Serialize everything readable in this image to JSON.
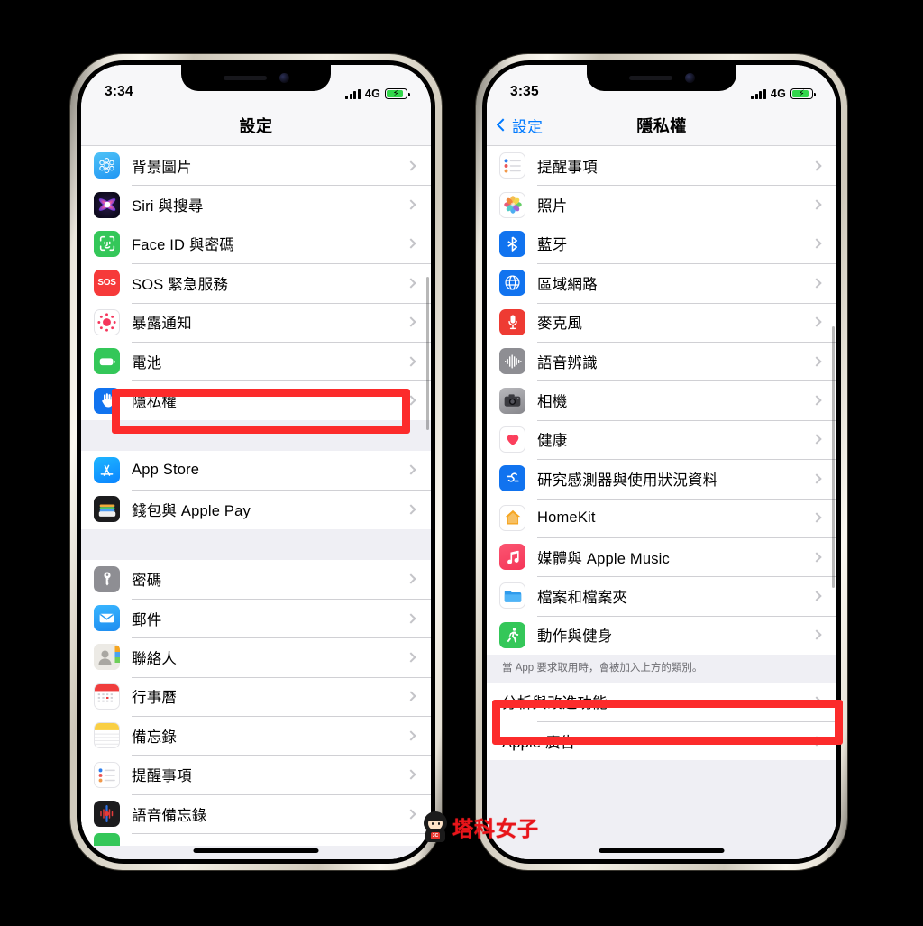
{
  "watermark": {
    "text": "塔科女子",
    "badge": "3C"
  },
  "phones": [
    {
      "id": "phone-settings",
      "status": {
        "time": "3:34",
        "network": "4G",
        "charging": true
      },
      "nav": {
        "title": "設定",
        "back_label": null
      },
      "sections": [
        {
          "type": "list",
          "rows": [
            {
              "label": "背景圖片",
              "icon": "wallpaper-icon"
            },
            {
              "label": "Siri 與搜尋",
              "icon": "siri-icon"
            },
            {
              "label": "Face ID 與密碼",
              "icon": "faceid-icon"
            },
            {
              "label": "SOS 緊急服務",
              "icon": "sos-icon"
            },
            {
              "label": "暴露通知",
              "icon": "exposure-notification-icon"
            },
            {
              "label": "電池",
              "icon": "battery-icon"
            },
            {
              "label": "隱私權",
              "icon": "privacy-hand-icon",
              "highlighted": true
            }
          ]
        },
        {
          "type": "gap"
        },
        {
          "type": "list",
          "rows": [
            {
              "label": "App Store",
              "icon": "appstore-icon"
            },
            {
              "label": "錢包與 Apple Pay",
              "icon": "wallet-icon"
            }
          ]
        },
        {
          "type": "gap"
        },
        {
          "type": "list",
          "rows": [
            {
              "label": "密碼",
              "icon": "passwords-key-icon"
            },
            {
              "label": "郵件",
              "icon": "mail-icon"
            },
            {
              "label": "聯絡人",
              "icon": "contacts-icon"
            },
            {
              "label": "行事曆",
              "icon": "calendar-icon"
            },
            {
              "label": "備忘錄",
              "icon": "notes-icon"
            },
            {
              "label": "提醒事項",
              "icon": "reminders-icon"
            },
            {
              "label": "語音備忘錄",
              "icon": "voice-memos-icon"
            }
          ]
        }
      ]
    },
    {
      "id": "phone-privacy",
      "status": {
        "time": "3:35",
        "network": "4G",
        "charging": true
      },
      "nav": {
        "title": "隱私權",
        "back_label": "設定"
      },
      "sections": [
        {
          "type": "list",
          "rows": [
            {
              "label": "提醒事項",
              "icon": "reminders-icon"
            },
            {
              "label": "照片",
              "icon": "photos-icon"
            },
            {
              "label": "藍牙",
              "icon": "bluetooth-icon"
            },
            {
              "label": "區域網路",
              "icon": "local-network-icon"
            },
            {
              "label": "麥克風",
              "icon": "microphone-icon"
            },
            {
              "label": "語音辨識",
              "icon": "speech-recognition-icon"
            },
            {
              "label": "相機",
              "icon": "camera-icon"
            },
            {
              "label": "健康",
              "icon": "health-icon"
            },
            {
              "label": "研究感測器與使用狀況資料",
              "icon": "research-sensor-icon"
            },
            {
              "label": "HomeKit",
              "icon": "homekit-icon"
            },
            {
              "label": "媒體與 Apple Music",
              "icon": "apple-music-icon"
            },
            {
              "label": "檔案和檔案夾",
              "icon": "files-folder-icon"
            },
            {
              "label": "動作與健身",
              "icon": "fitness-icon"
            }
          ]
        },
        {
          "type": "footnote",
          "text": "當 App 要求取用時，會被加入上方的類別。"
        },
        {
          "type": "list",
          "plain": true,
          "rows": [
            {
              "label": "分析與改進功能",
              "highlighted": true
            },
            {
              "label": "Apple 廣告"
            }
          ]
        }
      ]
    }
  ],
  "colors": {
    "highlight": "#fc2b2b",
    "accent": "#007aff",
    "battery": "#32d74b"
  }
}
